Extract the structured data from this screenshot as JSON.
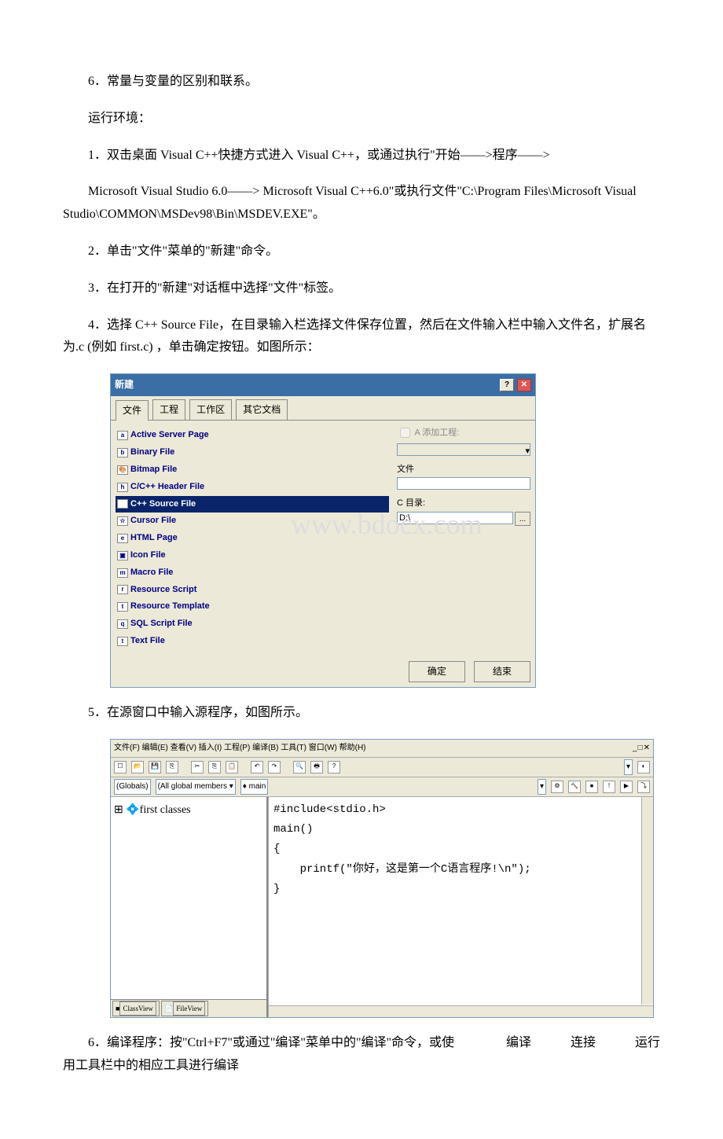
{
  "paras": {
    "p0": "6．常量与变量的区别和联系。",
    "p1": "运行环境：",
    "p2": "1．双击桌面 Visual C++快捷方式进入 Visual C++，或通过执行\"开始——>程序——>",
    "p3": "Microsoft Visual Studio 6.0——> Microsoft Visual C++6.0\"或执行文件\"C:\\Program Files\\Microsoft Visual Studio\\COMMON\\MSDev98\\Bin\\MSDEV.EXE\"。",
    "p4": "2．单击\"文件\"菜单的\"新建\"命令。",
    "p5": "3．在打开的\"新建\"对话框中选择\"文件\"标签。",
    "p6": "4．选择 C++ Source File，在目录输入栏选择文件保存位置，然后在文件输入栏中输入文件名，扩展名为.c (例如 first.c) ，单击确定按钮。如图所示：",
    "p7": "5．在源窗口中输入源程序，如图所示。",
    "p8": "6．编译程序：按\"Ctrl+F7\"或通过\"编译\"菜单中的\"编译\"命令，或使用工具栏中的相应工具进行编译",
    "p8b": "编译",
    "p8c": "连接",
    "p8d": "运行"
  },
  "dialog": {
    "title": "新建",
    "tabs": [
      "文件",
      "工程",
      "工作区",
      "其它文档"
    ],
    "items": [
      "Active Server Page",
      "Binary File",
      "Bitmap File",
      "C/C++ Header File",
      "C++ Source File",
      "Cursor File",
      "HTML Page",
      "Icon File",
      "Macro File",
      "Resource Script",
      "Resource Template",
      "SQL Script File",
      "Text File"
    ],
    "add_proj": "A 添加工程:",
    "file_label": "文件",
    "dir_label": "C 目录:",
    "dir_value": "D:\\",
    "ok": "确定",
    "cancel": "结束",
    "watermark": "www.bdocx.com"
  },
  "ide": {
    "menubar": "文件(F) 编辑(E) 查看(V) 插入(I) 工程(P) 编译(B) 工具(T) 窗口(W) 帮助(H)",
    "drop1": "(Globals)",
    "drop2": "(All global members ▾",
    "drop3": "♦ main",
    "tree_item": "first classes",
    "tree_tabs": [
      "ClassView",
      "FileView"
    ],
    "code_line1": "#include<stdio.h>",
    "code_line2": "main()",
    "code_line3": "{",
    "code_line4": "    printf(\"你好，这是第一个C语言程序!\\n\");",
    "code_line5": "}"
  }
}
